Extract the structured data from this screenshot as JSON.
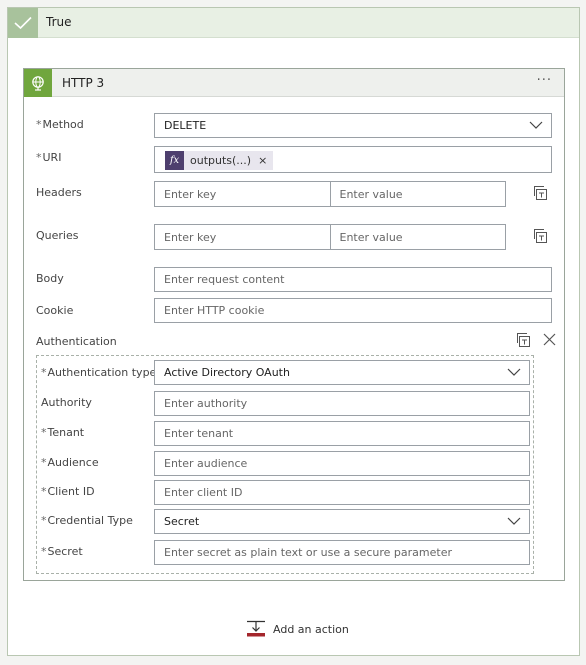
{
  "scope": {
    "title": "True"
  },
  "http": {
    "title": "HTTP 3",
    "menu_glyph": "···",
    "method": {
      "label": "Method",
      "required": "*",
      "value": "DELETE"
    },
    "uri": {
      "label": "URI",
      "required": "*",
      "token_label": "outputs(...)",
      "token_fx": "fx",
      "token_remove": "×"
    },
    "headers": {
      "label": "Headers",
      "key_placeholder": "Enter key",
      "value_placeholder": "Enter value"
    },
    "queries": {
      "label": "Queries",
      "key_placeholder": "Enter key",
      "value_placeholder": "Enter value"
    },
    "body": {
      "label": "Body",
      "placeholder": "Enter request content"
    },
    "cookie": {
      "label": "Cookie",
      "placeholder": "Enter HTTP cookie"
    },
    "authentication": {
      "label": "Authentication",
      "close_glyph": "×",
      "type": {
        "label": "Authentication type",
        "required": "*",
        "value": "Active Directory OAuth"
      },
      "authority": {
        "label": "Authority",
        "placeholder": "Enter authority"
      },
      "tenant": {
        "label": "Tenant",
        "required": "*",
        "placeholder": "Enter tenant"
      },
      "audience": {
        "label": "Audience",
        "required": "*",
        "placeholder": "Enter audience"
      },
      "client_id": {
        "label": "Client ID",
        "required": "*",
        "placeholder": "Enter client ID"
      },
      "credential_type": {
        "label": "Credential Type",
        "required": "*",
        "value": "Secret"
      },
      "secret": {
        "label": "Secret",
        "required": "*",
        "placeholder": "Enter secret as plain text or use a secure parameter"
      }
    }
  },
  "add_action": {
    "label": "Add an action"
  },
  "icons": {
    "scope": "checkmark-icon",
    "http": "globe-icon",
    "menu": "more-options-icon",
    "dropdown": "chevron-down-icon",
    "mode_switch": "text-mode-icon",
    "close": "close-icon",
    "add_action": "add-action-icon"
  },
  "colors": {
    "scope_icon_bg": "#a8c29c",
    "http_icon_bg": "#70a63d",
    "fx_token_bg": "#4e3f6e"
  }
}
